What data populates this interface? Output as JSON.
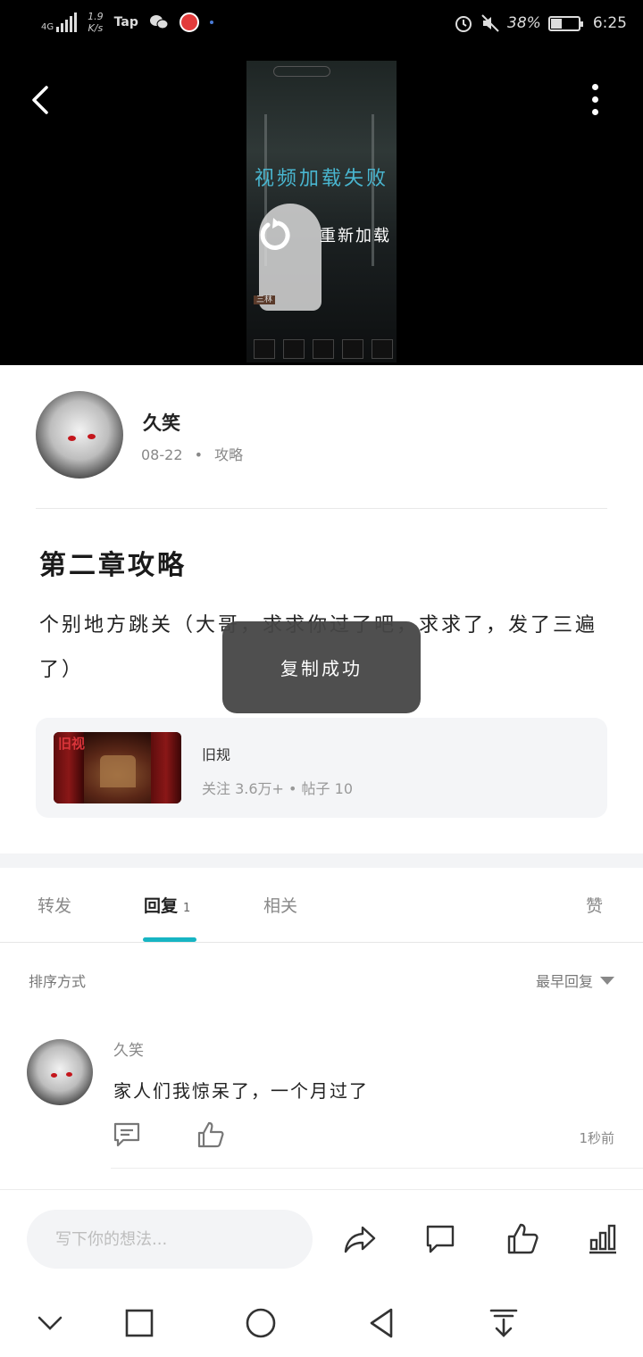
{
  "status_bar": {
    "network": "4G",
    "speed_value": "1.9",
    "speed_unit": "K/s",
    "tap_label": "Tap",
    "battery": "38%",
    "time": "6:25"
  },
  "video": {
    "error_text": "视频加载失败",
    "reload_label": "重新加载",
    "caption_tag": "三林"
  },
  "author": {
    "name": "久笑",
    "date": "08-22",
    "separator": "•",
    "category": "攻略"
  },
  "post": {
    "title": "第二章攻略",
    "body": "个别地方跳关（大哥，求求你过了吧，求求了，发了三遍了）"
  },
  "toast": {
    "text": "复制成功"
  },
  "game": {
    "logo_text": "旧视",
    "name": "旧规",
    "stats": "关注 3.6万+ • 帖子 10"
  },
  "tabs": [
    {
      "label": "转发",
      "count": ""
    },
    {
      "label": "回复",
      "count": "1"
    },
    {
      "label": "相关",
      "count": ""
    },
    {
      "label": "赞",
      "count": ""
    }
  ],
  "sort": {
    "label": "排序方式",
    "value": "最早回复"
  },
  "comment": {
    "author": "久笑",
    "text": "家人们我惊呆了，一个月过了",
    "time": "1秒前"
  },
  "action_bar": {
    "placeholder": "写下你的想法..."
  },
  "icons": {
    "back": "chevron-left-icon",
    "more": "more-vertical-icon",
    "reload": "refresh-icon",
    "reply": "comment-icon",
    "like": "thumbs-up-icon",
    "share": "share-icon",
    "stats": "bar-chart-icon"
  },
  "colors": {
    "accent": "#17b5c3",
    "video_error": "#49b6d0",
    "toast_bg": "#464646"
  }
}
